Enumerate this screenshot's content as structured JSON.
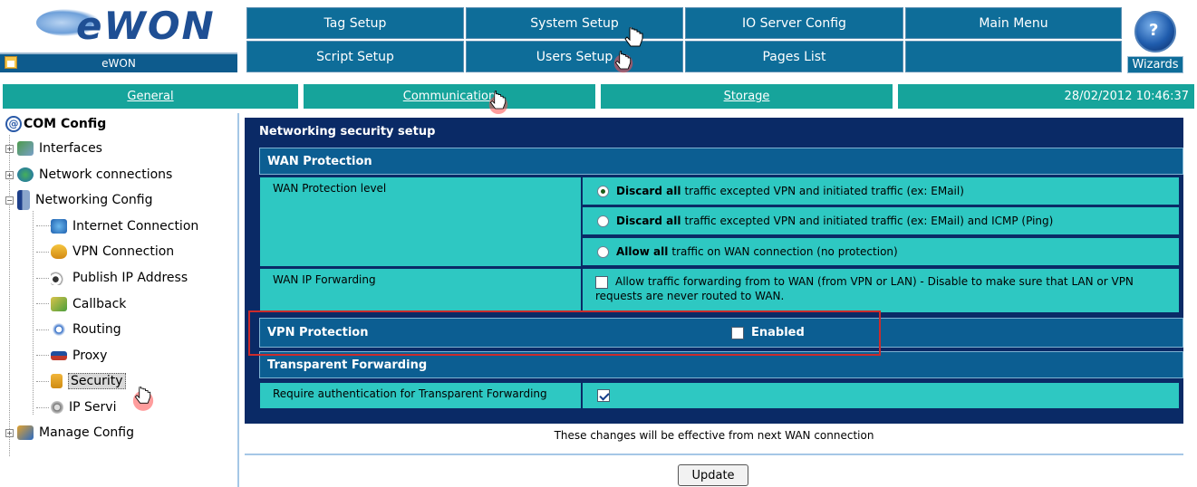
{
  "brand": {
    "logo_text": "eWON",
    "device_name": "eWON"
  },
  "topnav": {
    "row1": [
      "Tag Setup",
      "System Setup",
      "IO Server Config",
      "Main Menu"
    ],
    "row2": [
      "Script Setup",
      "Users Setup",
      "Pages List",
      ""
    ],
    "wizards_label": "Wizards"
  },
  "subnav": {
    "tabs": [
      "General",
      "Communication",
      "Storage"
    ],
    "datetime": "28/02/2012 10:46:37"
  },
  "tree": {
    "root": "COM Config",
    "items": [
      "Interfaces",
      "Network connections",
      "Networking Config",
      "Internet Connection",
      "VPN Connection",
      "Publish IP Address",
      "Callback",
      "Routing",
      "Proxy",
      "Security",
      "IP Servi",
      "Manage Config"
    ]
  },
  "panel": {
    "title": "Networking security setup",
    "wan_protection": {
      "heading": "WAN Protection",
      "level_label": "WAN Protection level",
      "options": [
        {
          "bold": "Discard all",
          "rest": "traffic excepted VPN and initiated traffic (ex: EMail)",
          "selected": true
        },
        {
          "bold": "Discard all",
          "rest": "traffic excepted VPN and initiated traffic (ex: EMail) and ICMP (Ping)",
          "selected": false
        },
        {
          "bold": "Allow all",
          "rest": "traffic on WAN connection (no protection)",
          "selected": false
        }
      ],
      "forwarding_label": "WAN IP Forwarding",
      "forwarding_text_line1": "Allow traffic forwarding from to WAN (from VPN or LAN) - Disable to make sure that LAN or VPN",
      "forwarding_text_line2": "requests are never routed to WAN.",
      "forwarding_checked": false
    },
    "vpn_protection": {
      "heading": "VPN Protection",
      "enabled_label": "Enabled",
      "enabled_checked": false
    },
    "transparent_forwarding": {
      "heading": "Transparent Forwarding",
      "auth_label": "Require authentication for Transparent Forwarding",
      "auth_checked": true
    }
  },
  "note": "These changes will be effective from next WAN connection",
  "update_label": "Update",
  "colors": {
    "nav_blue": "#0e6d99",
    "teal": "#16a49b",
    "cell_cyan": "#2ec8c2",
    "panel_navy": "#0a2a66",
    "highlight_red": "#cc2b2b"
  }
}
